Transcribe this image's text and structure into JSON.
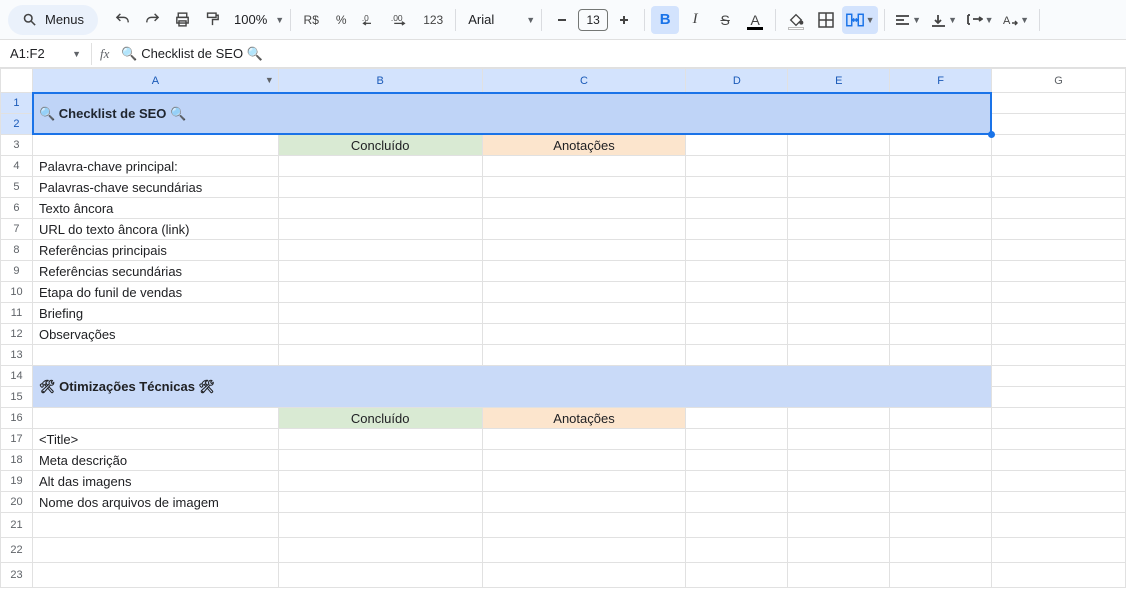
{
  "toolbar": {
    "menus_label": "Menus",
    "zoom_label": "100%",
    "currency_label": "R$",
    "percent_label": "%",
    "dec_minus_label": ".0←",
    "dec_plus_label": ".00→",
    "numfmt_label": "123",
    "font_name": "Arial",
    "font_size": "13"
  },
  "namebox": {
    "ref": "A1:F2"
  },
  "formula_bar": {
    "content": "🔍 Checklist de SEO 🔍"
  },
  "columns": [
    "A",
    "B",
    "C",
    "D",
    "E",
    "F",
    "G"
  ],
  "row_numbers": [
    "1",
    "2",
    "3",
    "4",
    "5",
    "6",
    "7",
    "8",
    "9",
    "10",
    "11",
    "12",
    "13",
    "14",
    "15",
    "16",
    "17",
    "18",
    "19",
    "20",
    "21",
    "22",
    "23"
  ],
  "sections": {
    "seo_title": "🔍 Checklist de SEO 🔍",
    "tech_title": "🛠 Otimizações Técnicas 🛠",
    "col_concluido": "Concluído",
    "col_anotacoes": "Anotações"
  },
  "rows_seo": [
    "Palavra-chave principal:",
    "Palavras-chave secundárias",
    "Texto âncora",
    "URL do texto âncora (link)",
    "Referências principais",
    "Referências secundárias",
    "Etapa do funil de vendas",
    "Briefing",
    "Observações"
  ],
  "rows_tech": [
    "<Title>",
    "Meta descrição",
    "Alt das imagens",
    "Nome dos arquivos de imagem"
  ]
}
